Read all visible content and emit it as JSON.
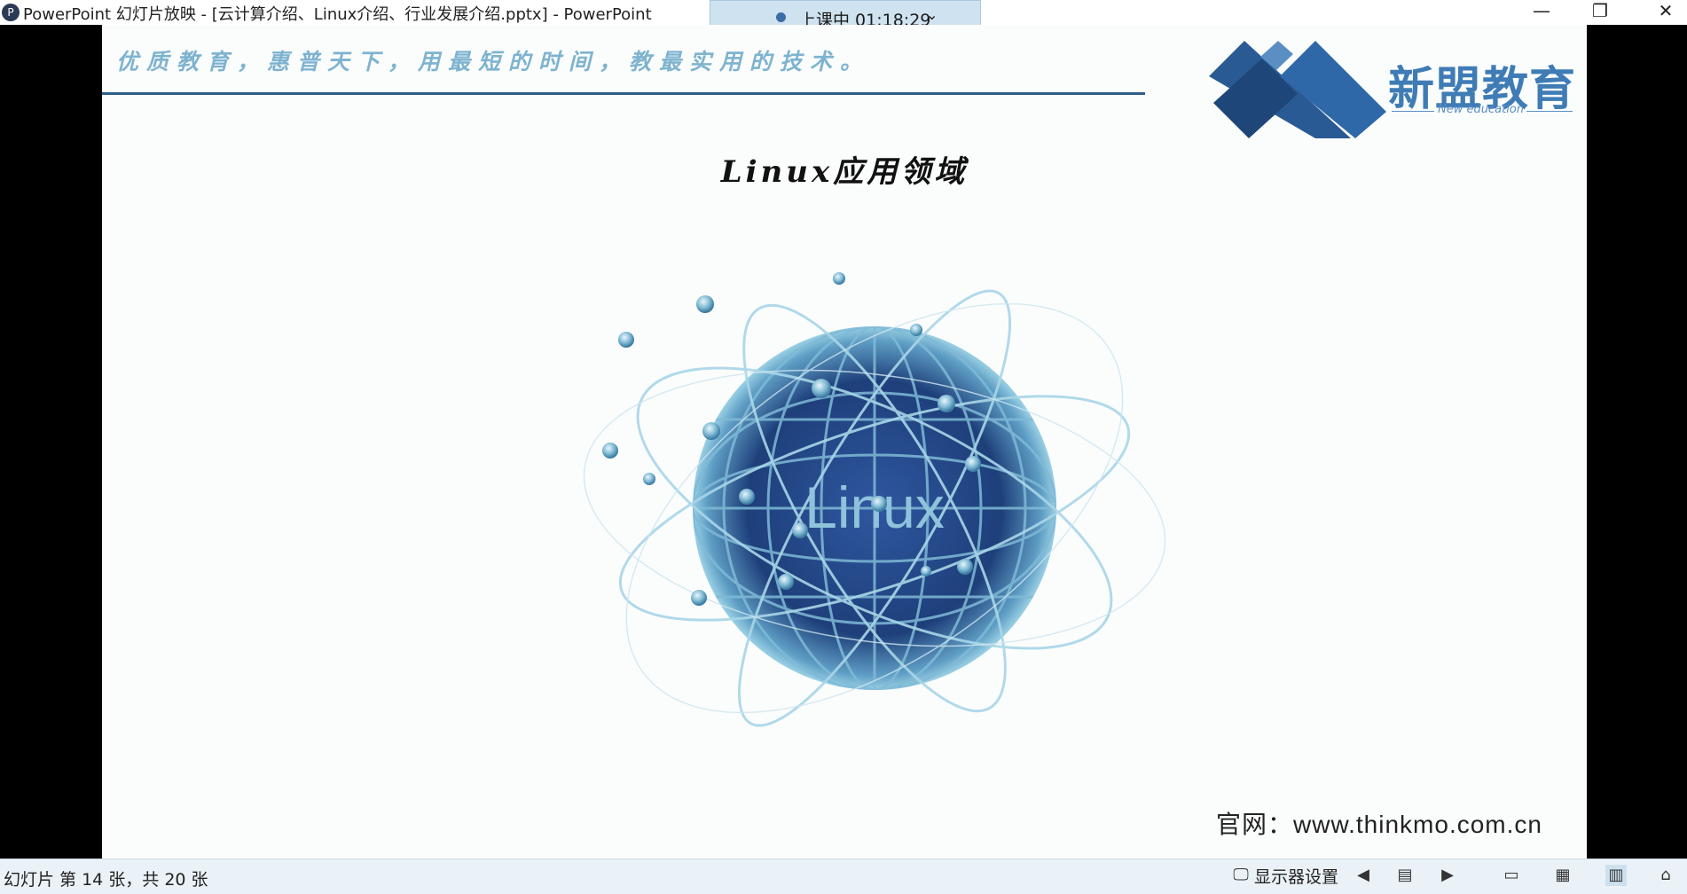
{
  "window": {
    "title": "PowerPoint 幻灯片放映 - [云计算介绍、Linux介绍、行业发展介绍.pptx] - PowerPoint",
    "minimize_glyph": "—",
    "restore_glyph": "❐",
    "close_glyph": "✕"
  },
  "recording": {
    "status": "上课中 01:18:29",
    "chevron": "⌄"
  },
  "slide": {
    "motto": "优质教育，惠普天下，用最短的时间，教最实用的技术。",
    "logo_cn": "新盟教育",
    "logo_en": "New education",
    "title": "Linux应用领域",
    "globe_label": "Linux",
    "website": "官网：www.thinkmo.com.cn"
  },
  "statusbar": {
    "slide_counter": "幻灯片 第 14 张，共 20 张",
    "display_settings": "显示器设置"
  },
  "colors": {
    "brand_blue": "#2f5e8a",
    "motto_blue": "#7eb3cf",
    "globe_dark": "#1e3f7a",
    "globe_light": "#8cc4dc"
  }
}
